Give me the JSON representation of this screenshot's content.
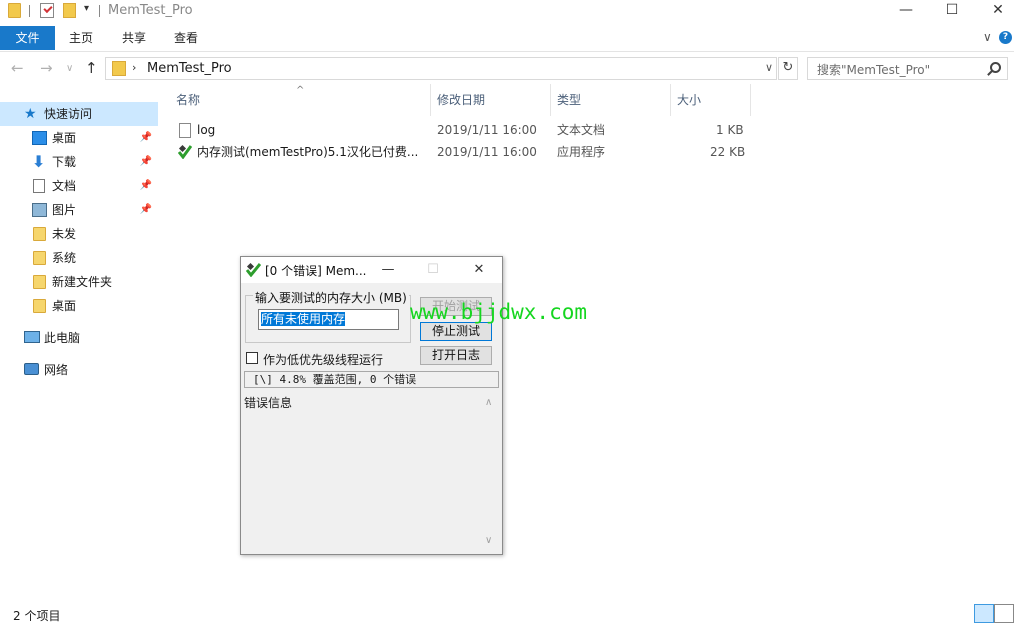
{
  "window": {
    "title": "MemTest_Pro",
    "minimize": "—",
    "maximize": "☐",
    "close": "✕"
  },
  "ribbon": {
    "tabs": [
      "文件",
      "主页",
      "共享",
      "查看"
    ],
    "expand": "∨",
    "help": "?"
  },
  "address": {
    "back": "←",
    "forward": "→",
    "recent": "∨",
    "up": "↑",
    "separator": "›",
    "path": "MemTest_Pro",
    "dropdown": "∨",
    "refresh": "↻",
    "search_placeholder": "搜索\"MemTest_Pro\""
  },
  "sidebar": {
    "items": [
      {
        "label": "快速访问",
        "icon": "star-icon",
        "pinned": false
      },
      {
        "label": "桌面",
        "icon": "desktop-icon",
        "pinned": true
      },
      {
        "label": "下载",
        "icon": "download-icon",
        "pinned": true
      },
      {
        "label": "文档",
        "icon": "document-icon",
        "pinned": true
      },
      {
        "label": "图片",
        "icon": "picture-icon",
        "pinned": true
      },
      {
        "label": "未发",
        "icon": "folder-icon",
        "pinned": false
      },
      {
        "label": "系统",
        "icon": "folder-icon",
        "pinned": false
      },
      {
        "label": "新建文件夹",
        "icon": "folder-icon",
        "pinned": false
      },
      {
        "label": "桌面",
        "icon": "folder-icon",
        "pinned": false
      },
      {
        "label": "此电脑",
        "icon": "computer-icon",
        "pinned": false
      },
      {
        "label": "网络",
        "icon": "network-icon",
        "pinned": false
      }
    ],
    "pin_glyph": "📌"
  },
  "columns": {
    "name": "名称",
    "modified": "修改日期",
    "type": "类型",
    "size": "大小",
    "sort_glyph": "^"
  },
  "files": [
    {
      "name": "log",
      "modified": "2019/1/11 16:00",
      "type": "文本文档",
      "size": "1 KB",
      "icon": "text-file-icon"
    },
    {
      "name": "内存测试(memTestPro)5.1汉化已付费...",
      "modified": "2019/1/11 16:00",
      "type": "应用程序",
      "size": "22 KB",
      "icon": "memtest-app-icon"
    }
  ],
  "status": {
    "item_count": "2 个项目"
  },
  "dialog": {
    "title": "[0 个错误] Mem...",
    "minimize": "—",
    "maximize": "☐",
    "close": "✕",
    "group_label": "输入要测试的内存大小 (MB)",
    "mem_value": "所有未使用内存",
    "start_button": "开始测试",
    "stop_button": "停止测试",
    "log_button": "打开日志",
    "low_priority_label": "作为低优先级线程运行",
    "progress": "[\\]   4.8% 覆盖范围, 0 个错误",
    "error_label": "错误信息",
    "scroll_up": "∧",
    "scroll_down": "∨"
  },
  "watermark": "www.bjjdwx.com",
  "colors": {
    "accent": "#1979ca",
    "selection": "#cce8ff",
    "watermark": "#15d61f"
  }
}
